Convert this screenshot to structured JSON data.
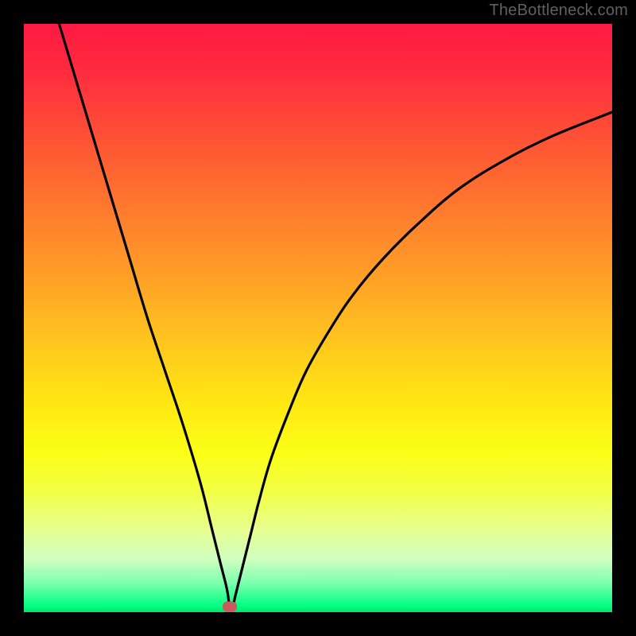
{
  "watermark": "TheBottleneck.com",
  "chart_data": {
    "type": "line",
    "title": "",
    "xlabel": "",
    "ylabel": "",
    "xlim": [
      0,
      100
    ],
    "ylim": [
      0,
      100
    ],
    "curve": {
      "x": [
        6,
        9,
        12,
        15,
        18,
        21,
        24,
        27,
        30,
        32,
        33.5,
        34.5,
        35,
        35.5,
        36,
        37,
        38.5,
        40,
        42,
        45,
        48,
        52,
        56,
        61,
        67,
        74,
        82,
        90,
        100
      ],
      "y": [
        100,
        90,
        80,
        70,
        60,
        50,
        41,
        32,
        22,
        14,
        8,
        4,
        1,
        1,
        3,
        7,
        13,
        19,
        26,
        34,
        41,
        48,
        54,
        60,
        66,
        72,
        77,
        81,
        85
      ]
    },
    "marker": {
      "x": 35,
      "y": 1
    },
    "gradient_stops": [
      {
        "pos": 0,
        "color": "#ff1a42"
      },
      {
        "pos": 22,
        "color": "#ff5a33"
      },
      {
        "pos": 53,
        "color": "#ffc21f"
      },
      {
        "pos": 73,
        "color": "#fbff16"
      },
      {
        "pos": 91,
        "color": "#d0ffc0"
      },
      {
        "pos": 100,
        "color": "#00e56c"
      }
    ]
  }
}
